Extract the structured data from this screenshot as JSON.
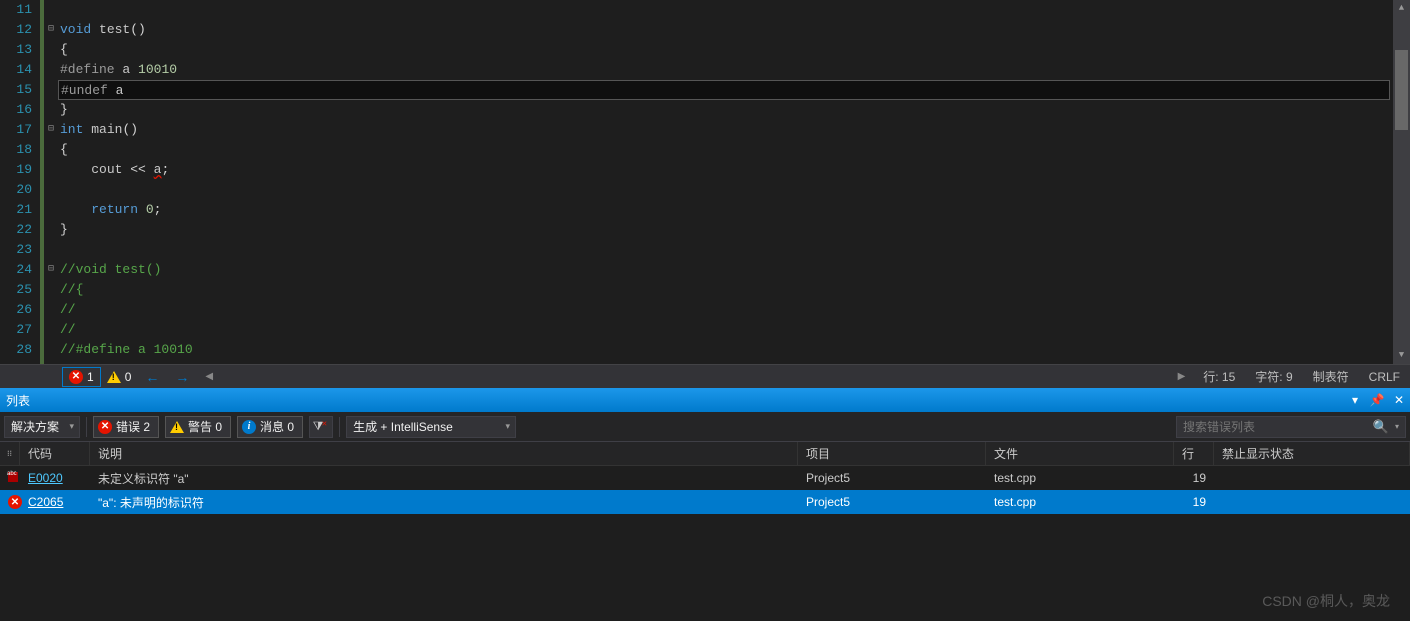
{
  "editor": {
    "lines": [
      {
        "n": "11",
        "fold": "",
        "html": []
      },
      {
        "n": "12",
        "fold": "⊟",
        "html": [
          [
            "kw",
            "void"
          ],
          [
            " "
          ],
          [
            "ident",
            "test"
          ],
          [
            "punc",
            "()"
          ]
        ]
      },
      {
        "n": "13",
        "fold": "",
        "html": [
          [
            "punc",
            "{"
          ]
        ]
      },
      {
        "n": "14",
        "fold": "",
        "html": [
          [
            "pre",
            "#define "
          ],
          [
            "ident",
            "a"
          ],
          [
            " "
          ],
          [
            "num",
            "10010"
          ]
        ]
      },
      {
        "n": "15",
        "fold": "",
        "current": true,
        "html": [
          [
            "pre",
            "#undef "
          ],
          [
            "ident",
            "a"
          ]
        ]
      },
      {
        "n": "16",
        "fold": "",
        "html": [
          [
            "punc",
            "}"
          ]
        ]
      },
      {
        "n": "17",
        "fold": "⊟",
        "html": [
          [
            "kw",
            "int"
          ],
          [
            " "
          ],
          [
            "ident",
            "main"
          ],
          [
            "punc",
            "()"
          ]
        ]
      },
      {
        "n": "18",
        "fold": "",
        "html": [
          [
            "punc",
            "{"
          ]
        ]
      },
      {
        "n": "19",
        "fold": "",
        "html": [
          [
            "    "
          ],
          [
            "ident",
            "cout"
          ],
          [
            " "
          ],
          [
            "punc",
            "<<"
          ],
          [
            " "
          ],
          [
            "ident underline",
            "a"
          ],
          [
            "punc",
            ";"
          ]
        ]
      },
      {
        "n": "20",
        "fold": "",
        "html": []
      },
      {
        "n": "21",
        "fold": "",
        "html": [
          [
            "    "
          ],
          [
            "kw",
            "return"
          ],
          [
            " "
          ],
          [
            "num",
            "0"
          ],
          [
            "punc",
            ";"
          ]
        ]
      },
      {
        "n": "22",
        "fold": "",
        "html": [
          [
            "punc",
            "}"
          ]
        ]
      },
      {
        "n": "23",
        "fold": "",
        "html": []
      },
      {
        "n": "24",
        "fold": "⊟",
        "html": [
          [
            "comment",
            "//void test()"
          ]
        ]
      },
      {
        "n": "25",
        "fold": "",
        "html": [
          [
            "comment",
            "//{"
          ]
        ]
      },
      {
        "n": "26",
        "fold": "",
        "html": [
          [
            "comment",
            "//"
          ]
        ]
      },
      {
        "n": "27",
        "fold": "",
        "html": [
          [
            "comment",
            "//"
          ]
        ]
      },
      {
        "n": "28",
        "fold": "",
        "html": [
          [
            "comment",
            "//#define a 10010"
          ]
        ]
      }
    ]
  },
  "statusbar": {
    "errors_count": "1",
    "warnings_count": "0",
    "line_label": "行: 15",
    "col_label": "字符: 9",
    "indent_label": "制表符",
    "eol_label": "CRLF"
  },
  "error_panel": {
    "title": "列表",
    "scope_combo": "解决方案",
    "errors_filter": "错误 2",
    "warnings_filter": "警告 0",
    "info_filter": "消息 0",
    "build_combo": "生成 + IntelliSense",
    "search_placeholder": "搜索错误列表",
    "columns": {
      "code": "代码",
      "desc": "说明",
      "proj": "项目",
      "file": "文件",
      "line": "行",
      "sup": "禁止显示状态"
    },
    "rows": [
      {
        "icon": "intellisense",
        "code": "E0020",
        "desc": "未定义标识符 \"a\"",
        "proj": "Project5",
        "file": "test.cpp",
        "line": "19",
        "selected": false,
        "link": true
      },
      {
        "icon": "error",
        "code": "C2065",
        "desc": "\"a\": 未声明的标识符",
        "proj": "Project5",
        "file": "test.cpp",
        "line": "19",
        "selected": true,
        "link": true
      }
    ]
  },
  "watermark": "CSDN @桐人，奥龙"
}
